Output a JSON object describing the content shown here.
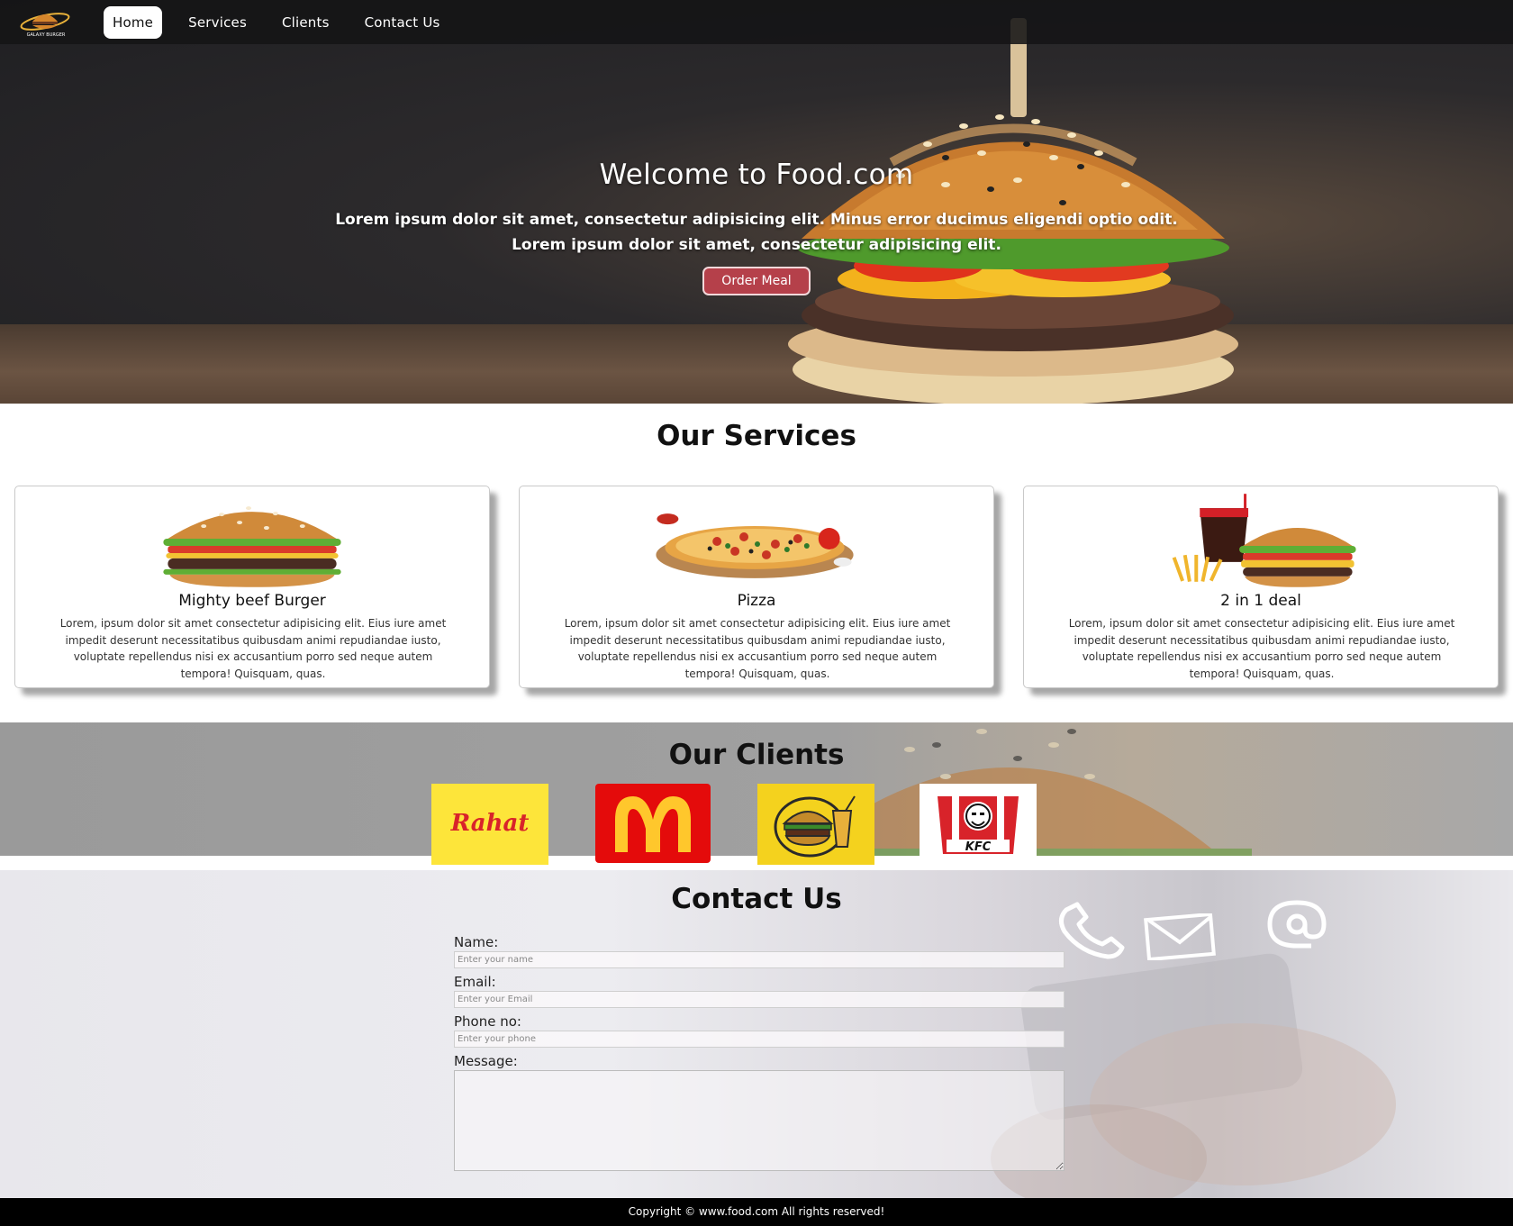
{
  "nav": {
    "items": [
      {
        "label": "Home",
        "active": true
      },
      {
        "label": "Services",
        "active": false
      },
      {
        "label": "Clients",
        "active": false
      },
      {
        "label": "Contact Us",
        "active": false
      }
    ],
    "logo_icon": "planet-burger-logo"
  },
  "hero": {
    "title": "Welcome to Food.com",
    "line1": "Lorem ipsum dolor sit amet, consectetur adipisicing elit. Minus error ducimus eligendi optio odit.",
    "line2": "Lorem ipsum dolor sit amet, consectetur adipisicing elit.",
    "button": "Order Meal",
    "button_color": "#b5404a"
  },
  "services": {
    "title": "Our Services",
    "cards": [
      {
        "title": "Mighty beef Burger",
        "icon": "burger-image",
        "text": "Lorem, ipsum dolor sit amet consectetur adipisicing elit. Eius iure amet impedit deserunt necessitatibus quibusdam animi repudiandae iusto, voluptate repellendus nisi ex accusantium porro sed neque autem tempora! Quisquam, quas."
      },
      {
        "title": "Pizza",
        "icon": "pizza-image",
        "text": "Lorem, ipsum dolor sit amet consectetur adipisicing elit. Eius iure amet impedit deserunt necessitatibus quibusdam animi repudiandae iusto, voluptate repellendus nisi ex accusantium porro sed neque autem tempora! Quisquam, quas."
      },
      {
        "title": "2 in 1 deal",
        "icon": "combo-deal-image",
        "text": "Lorem, ipsum dolor sit amet consectetur adipisicing elit. Eius iure amet impedit deserunt necessitatibus quibusdam animi repudiandae iusto, voluptate repellendus nisi ex accusantium porro sed neque autem tempora! Quisquam, quas."
      }
    ]
  },
  "clients": {
    "title": "Our Clients",
    "logos": [
      {
        "name": "Rahat",
        "icon": "rahat-logo",
        "bg": "#fde53a",
        "color": "#d8232a"
      },
      {
        "name": "McDonald's",
        "icon": "mcdonalds-logo",
        "bg": "#e40b0b",
        "color": "#ffc72c"
      },
      {
        "name": "Burger",
        "icon": "burger-drink-logo",
        "bg": "#f4d21e",
        "color": "#2a2a2a"
      },
      {
        "name": "KFC",
        "icon": "kfc-logo",
        "bg": "#ffffff",
        "color": "#d8232a"
      }
    ]
  },
  "contact": {
    "title": "Contact Us",
    "name_label": "Name:",
    "name_placeholder": "Enter your name",
    "email_label": "Email:",
    "email_placeholder": "Enter your Email",
    "phone_label": "Phone no:",
    "phone_placeholder": "Enter your phone",
    "message_label": "Message:",
    "decor_icons": [
      "phone-icon",
      "envelope-icon",
      "at-sign-icon"
    ]
  },
  "footer": {
    "text": "Copyright © www.food.com All rights reserved!"
  }
}
